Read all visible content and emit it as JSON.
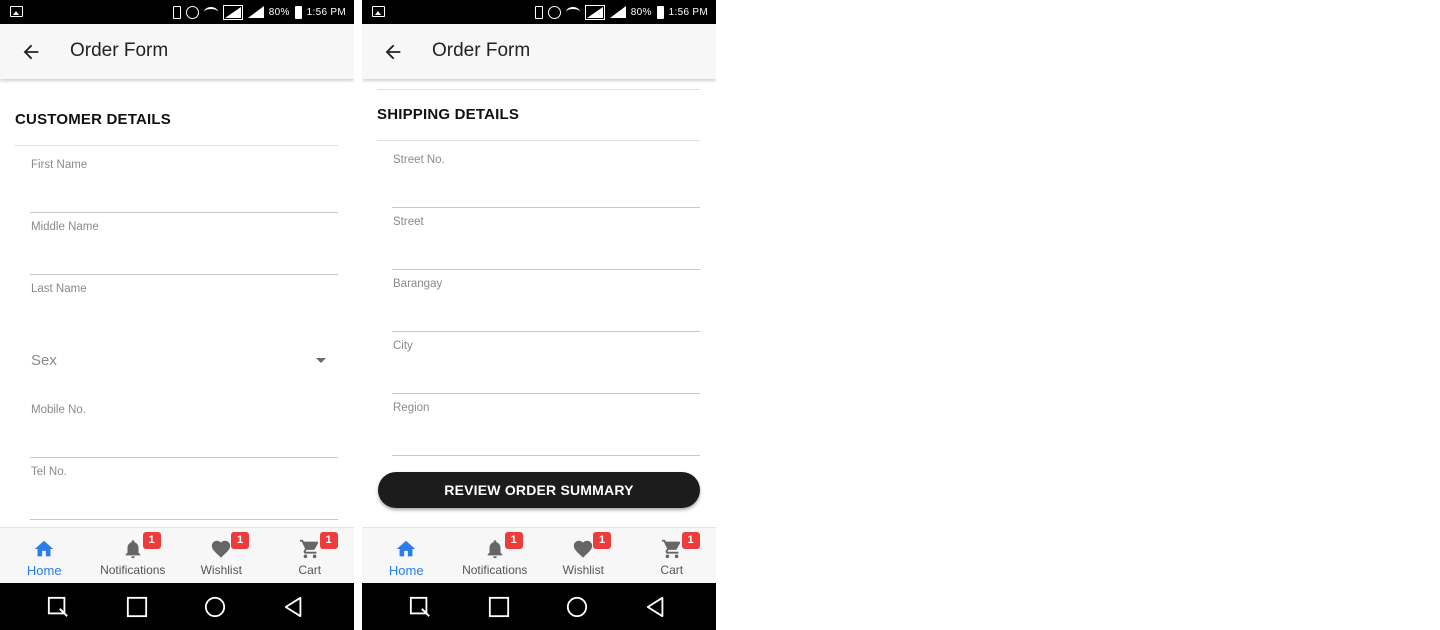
{
  "status_bar": {
    "battery": "80%",
    "time": "1:56 PM"
  },
  "app_bar": {
    "title": "Order Form"
  },
  "customer_section": {
    "title": "CUSTOMER DETAILS",
    "fields": [
      "First Name",
      "Middle Name",
      "Last Name"
    ],
    "sex_select": {
      "placeholder": "Sex"
    },
    "contact_fields": [
      "Mobile No.",
      "Tel No."
    ]
  },
  "shipping_section": {
    "title": "SHIPPING DETAILS",
    "fields": [
      "Street No.",
      "Street",
      "Barangay",
      "City",
      "Region"
    ],
    "review_button": "REVIEW ORDER SUMMARY"
  },
  "bottom_nav": {
    "items": [
      {
        "label": "Home",
        "icon": "home-icon",
        "active": true
      },
      {
        "label": "Notifications",
        "icon": "bell-icon",
        "badge": "1"
      },
      {
        "label": "Wishlist",
        "icon": "heart-icon",
        "badge": "1"
      },
      {
        "label": "Cart",
        "icon": "cart-icon",
        "badge": "1"
      }
    ],
    "active_color": "#2b7de9",
    "badge_color": "#ee3b3b"
  },
  "system_nav": {
    "buttons": [
      "search-icon",
      "square-icon",
      "circle-icon",
      "back-triangle-icon"
    ]
  }
}
